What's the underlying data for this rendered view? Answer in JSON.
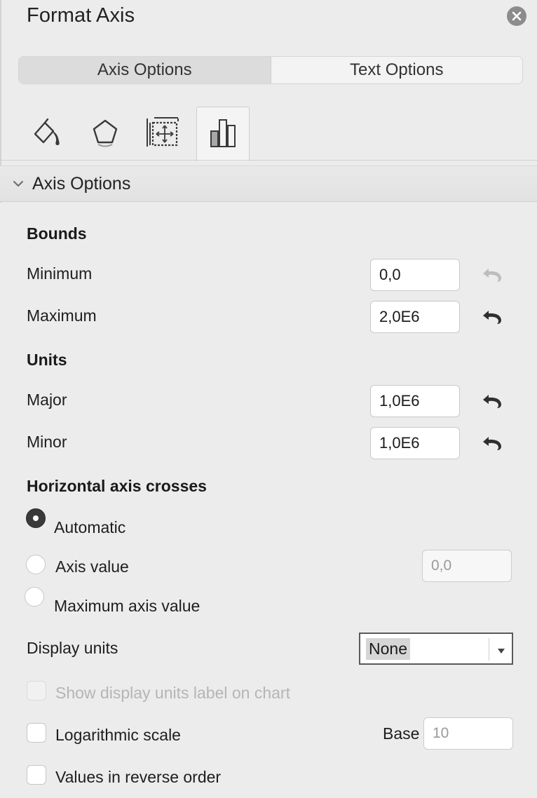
{
  "panel": {
    "title": "Format Axis",
    "tabs": [
      {
        "label": "Axis Options",
        "active": true
      },
      {
        "label": "Text Options",
        "active": false
      }
    ],
    "icon_tabs": [
      {
        "icon": "fill-line-icon",
        "active": false
      },
      {
        "icon": "effects-pentagon-icon",
        "active": false
      },
      {
        "icon": "size-properties-icon",
        "active": false
      },
      {
        "icon": "axis-options-bar-chart-icon",
        "active": true
      }
    ],
    "section": {
      "label": "Axis Options",
      "expanded": true
    }
  },
  "bounds": {
    "heading": "Bounds",
    "minimum": {
      "label": "Minimum",
      "value": "0,0",
      "reset_enabled": false
    },
    "maximum": {
      "label": "Maximum",
      "value": "2,0E6",
      "reset_enabled": true
    }
  },
  "units": {
    "heading": "Units",
    "major": {
      "label": "Major",
      "value": "1,0E6",
      "reset_enabled": true
    },
    "minor": {
      "label": "Minor",
      "value": "1,0E6",
      "reset_enabled": true
    }
  },
  "crosses": {
    "heading": "Horizontal axis crosses",
    "options": [
      {
        "label": "Automatic",
        "checked": true
      },
      {
        "label": "Axis value",
        "checked": false
      },
      {
        "label": "Maximum axis value",
        "checked": false
      }
    ],
    "axis_value_placeholder": "0,0"
  },
  "display_units": {
    "label": "Display units",
    "selected": "None"
  },
  "checkboxes": {
    "show_label": {
      "label": "Show display units label on chart",
      "checked": false,
      "disabled": true
    },
    "log_scale": {
      "label": "Logarithmic scale",
      "checked": false,
      "disabled": false
    },
    "reverse": {
      "label": "Values in reverse order",
      "checked": false,
      "disabled": false
    }
  },
  "log_base": {
    "label": "Base",
    "placeholder": "10"
  },
  "colors": {
    "panel_bg": "#ececec",
    "reset_active": "#2f2f2f",
    "reset_disabled": "#bdbdbd"
  }
}
